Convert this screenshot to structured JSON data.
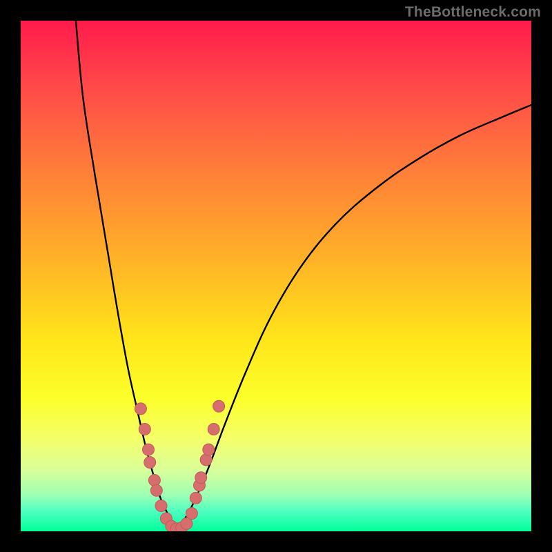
{
  "watermark": {
    "text": "TheBottleneck.com"
  },
  "colors": {
    "curve": "#000000",
    "marker_fill": "#d76e6e",
    "marker_stroke": "#c25a5a",
    "frame_bg": "#000000"
  },
  "chart_data": {
    "type": "line",
    "title": "",
    "xlabel": "",
    "ylabel": "",
    "xlim": [
      0,
      100
    ],
    "ylim": [
      0,
      100
    ],
    "note": "Two unlabeled curves descending into a V-shaped minimum near x≈28–32, y≈0; discrete markers cluster near the minimum. Values are estimated from pixel positions (no axes/ticks shown).",
    "series": [
      {
        "name": "left-branch",
        "x": [
          10.8,
          12.2,
          14.5,
          17.0,
          19.0,
          21.0,
          23.0,
          24.5,
          26.0,
          27.2,
          28.5,
          29.5,
          30.5
        ],
        "y": [
          100.0,
          85.0,
          70.0,
          55.0,
          43.0,
          32.0,
          23.0,
          16.5,
          11.0,
          7.0,
          4.0,
          2.0,
          0.5
        ]
      },
      {
        "name": "right-branch",
        "x": [
          30.5,
          32.5,
          34.5,
          37.0,
          40.0,
          44.0,
          49.0,
          55.0,
          62.0,
          70.0,
          78.0,
          86.0,
          94.0,
          100.0
        ],
        "y": [
          0.5,
          3.0,
          7.0,
          13.0,
          21.0,
          31.0,
          42.0,
          52.0,
          60.5,
          67.5,
          73.0,
          77.5,
          81.0,
          83.5
        ]
      }
    ],
    "markers": [
      {
        "x": 23.5,
        "y": 24.0
      },
      {
        "x": 24.3,
        "y": 20.0
      },
      {
        "x": 25.0,
        "y": 16.0
      },
      {
        "x": 25.3,
        "y": 13.5
      },
      {
        "x": 26.2,
        "y": 10.0
      },
      {
        "x": 26.6,
        "y": 8.0
      },
      {
        "x": 27.5,
        "y": 5.0
      },
      {
        "x": 28.5,
        "y": 2.5
      },
      {
        "x": 29.5,
        "y": 1.0
      },
      {
        "x": 30.5,
        "y": 0.5
      },
      {
        "x": 31.5,
        "y": 0.7
      },
      {
        "x": 32.5,
        "y": 1.5
      },
      {
        "x": 33.5,
        "y": 3.5
      },
      {
        "x": 34.3,
        "y": 6.5
      },
      {
        "x": 35.0,
        "y": 9.0
      },
      {
        "x": 35.3,
        "y": 10.5
      },
      {
        "x": 36.3,
        "y": 14.0
      },
      {
        "x": 36.8,
        "y": 16.0
      },
      {
        "x": 37.8,
        "y": 20.0
      },
      {
        "x": 38.8,
        "y": 24.5
      }
    ]
  }
}
